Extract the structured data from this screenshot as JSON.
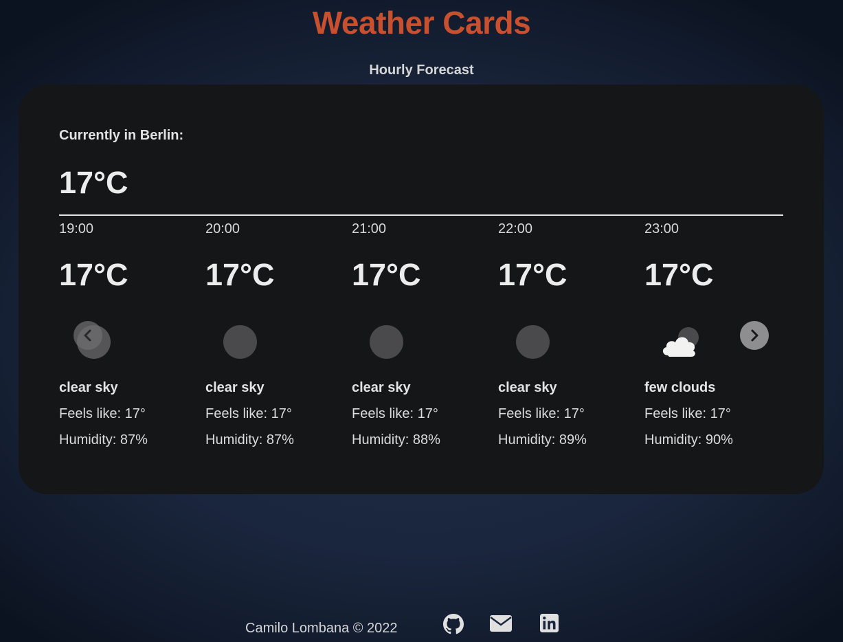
{
  "header": {
    "title": "Weather Cards",
    "subtitle": "Hourly Forecast"
  },
  "current": {
    "label": "Currently in Berlin:",
    "temperature": "17°C"
  },
  "forecast": [
    {
      "time": "19:00",
      "temp": "17°C",
      "icon": "moon-icon",
      "description": "clear sky",
      "feels_like": "Feels like: 17°",
      "humidity": "Humidity: 87%"
    },
    {
      "time": "20:00",
      "temp": "17°C",
      "icon": "moon-icon",
      "description": "clear sky",
      "feels_like": "Feels like: 17°",
      "humidity": "Humidity: 87%"
    },
    {
      "time": "21:00",
      "temp": "17°C",
      "icon": "moon-icon",
      "description": "clear sky",
      "feels_like": "Feels like: 17°",
      "humidity": "Humidity: 88%"
    },
    {
      "time": "22:00",
      "temp": "17°C",
      "icon": "moon-icon",
      "description": "clear sky",
      "feels_like": "Feels like: 17°",
      "humidity": "Humidity: 89%"
    },
    {
      "time": "23:00",
      "temp": "17°C",
      "icon": "cloud-moon-icon",
      "description": "few clouds",
      "feels_like": "Feels like: 17°",
      "humidity": "Humidity: 90%"
    }
  ],
  "carousel": {
    "prev_icon": "chevron-left-icon",
    "next_icon": "chevron-right-icon"
  },
  "footer": {
    "copyright": "Camilo Lombana © 2022",
    "links": [
      {
        "icon": "github-icon"
      },
      {
        "icon": "mail-icon"
      },
      {
        "icon": "linkedin-icon"
      }
    ]
  },
  "colors": {
    "title": "#c9502f",
    "card_background": "#151618",
    "page_background": "#1a263d"
  }
}
